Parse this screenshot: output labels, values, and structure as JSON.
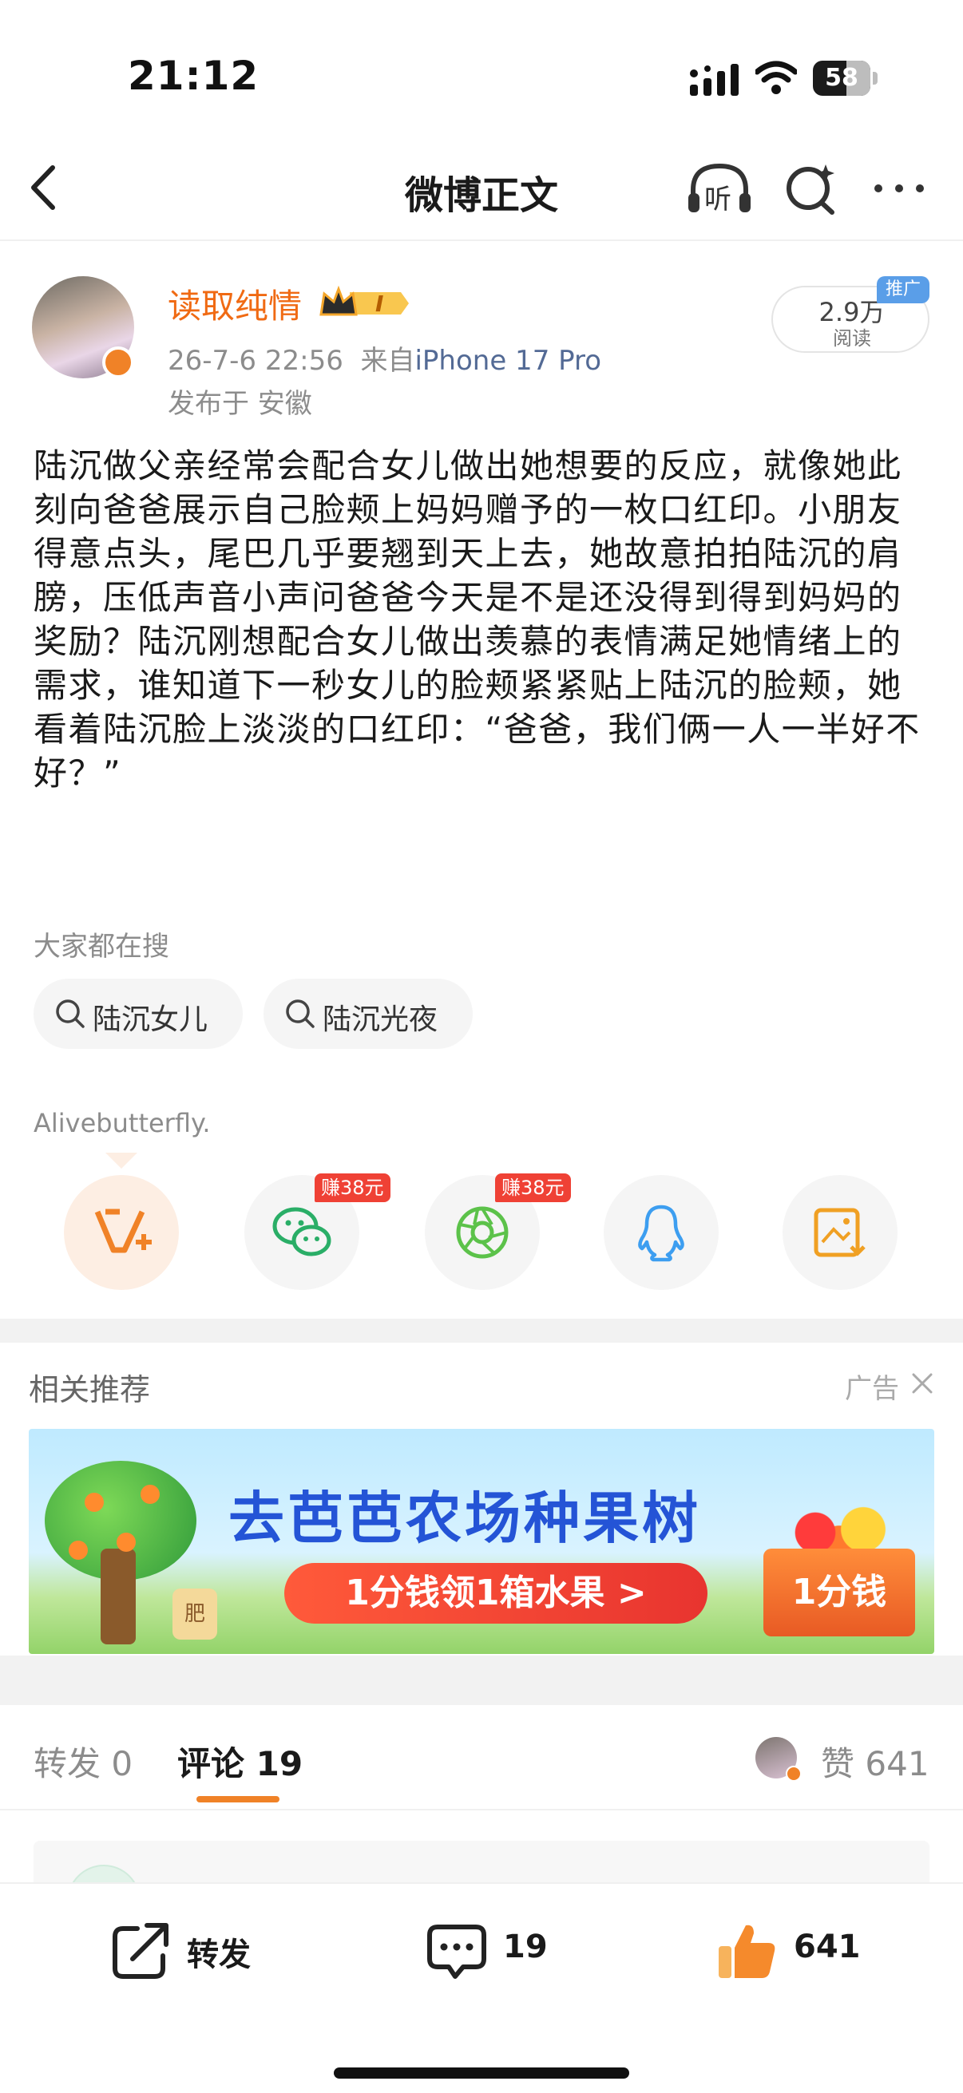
{
  "status_bar": {
    "time": "21:12",
    "battery": "58"
  },
  "nav": {
    "title": "微博正文",
    "listen_label": "听"
  },
  "author": {
    "username": "读取纯情",
    "level_badge": "I",
    "timestamp": "26-7-6 22:56",
    "source_prefix": "来自",
    "device": "iPhone 17 Pro",
    "location": "发布于 安徽"
  },
  "read_badge": {
    "count": "2.9万",
    "label": "阅读",
    "promo": "推广"
  },
  "post": {
    "body": "陆沉做父亲经常会配合女儿做出她想要的反应，就像她此刻向爸爸展示自己脸颊上妈妈赠予的一枚口红印。小朋友得意点头，尾巴几乎要翘到天上去，她故意拍拍陆沉的肩膀，压低声音小声问爸爸今天是不是还没得到得到妈妈的奖励？陆沉刚想配合女儿做出羡慕的表情满足她情绪上的需求，谁知道下一秒女儿的脸颊紧紧贴上陆沉的脸颊，她看着陆沉脸上淡淡的口红印：“爸爸，我们俩一人一半好不好？”"
  },
  "hot_search": {
    "title": "大家都在搜",
    "items": [
      "陆沉女儿",
      "陆沉光夜"
    ]
  },
  "signature": "Alivebutterfly.",
  "share": {
    "earn_tag": "赚38元",
    "icons": [
      "vplus-icon",
      "wechat-icon",
      "moments-icon",
      "qq-icon",
      "save-image-icon"
    ]
  },
  "related": {
    "title": "相关推荐",
    "ad_label": "广告",
    "ad_title": "去芭芭农场种果树",
    "ad_cta": "1分钱领1箱水果 >",
    "ad_box_text": "1分钱",
    "ad_fertilizer": "肥"
  },
  "tabs": {
    "repost_label": "转发",
    "repost_count": "0",
    "comment_label": "评论",
    "comment_count": "19",
    "likes_label": "赞",
    "likes_count": "641"
  },
  "bottom_bar": {
    "repost_label": "转发",
    "comment_count": "19",
    "like_count": "641"
  },
  "colors": {
    "accent_orange": "#f08227",
    "username_orange": "#f06a13",
    "device_blue": "#536a95",
    "earn_red": "#ef4135",
    "ad_title_blue": "#2454d6"
  }
}
